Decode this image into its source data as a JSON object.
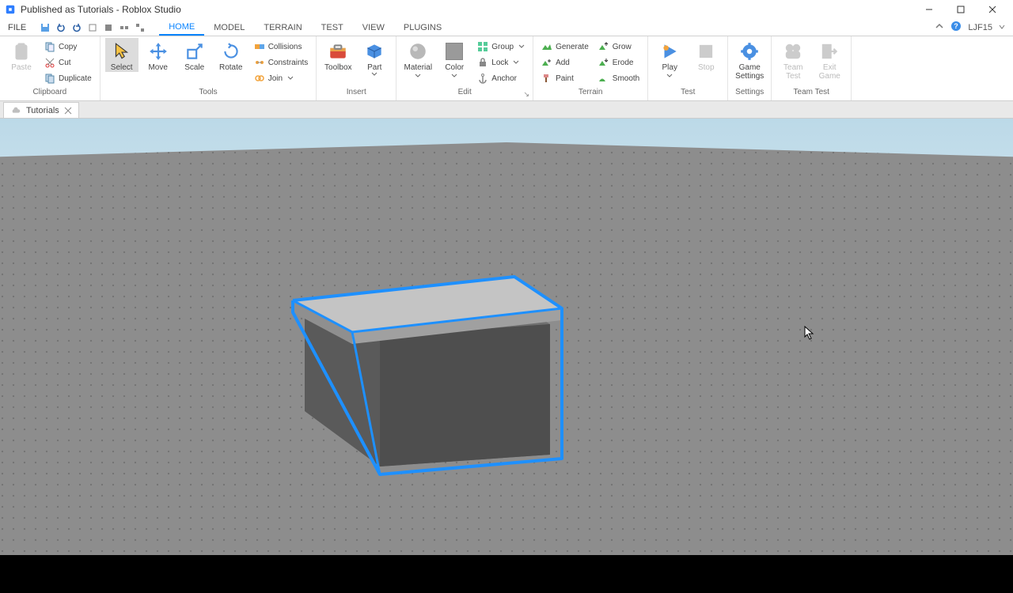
{
  "window": {
    "title": "Published as Tutorials - Roblox Studio"
  },
  "file_menu": "FILE",
  "tabs": [
    "HOME",
    "MODEL",
    "TERRAIN",
    "TEST",
    "VIEW",
    "PLUGINS"
  ],
  "active_tab": "HOME",
  "user": "LJF15",
  "ribbon": {
    "clipboard": {
      "label": "Clipboard",
      "paste": "Paste",
      "copy": "Copy",
      "cut": "Cut",
      "duplicate": "Duplicate"
    },
    "tools": {
      "label": "Tools",
      "select": "Select",
      "move": "Move",
      "scale": "Scale",
      "rotate": "Rotate",
      "collisions": "Collisions",
      "constraints": "Constraints",
      "join": "Join"
    },
    "insert": {
      "label": "Insert",
      "toolbox": "Toolbox",
      "part": "Part"
    },
    "edit": {
      "label": "Edit",
      "material": "Material",
      "color": "Color",
      "group": "Group",
      "lock": "Lock",
      "anchor": "Anchor"
    },
    "terrain": {
      "label": "Terrain",
      "generate": "Generate",
      "add": "Add",
      "paint": "Paint",
      "grow": "Grow",
      "erode": "Erode",
      "smooth": "Smooth"
    },
    "test": {
      "label": "Test",
      "play": "Play",
      "stop": "Stop"
    },
    "settings": {
      "label": "Settings",
      "game_settings": "Game\nSettings"
    },
    "teamtest": {
      "label": "Team Test",
      "team_test": "Team\nTest",
      "exit_game": "Exit\nGame"
    }
  },
  "doc_tab": "Tutorials"
}
